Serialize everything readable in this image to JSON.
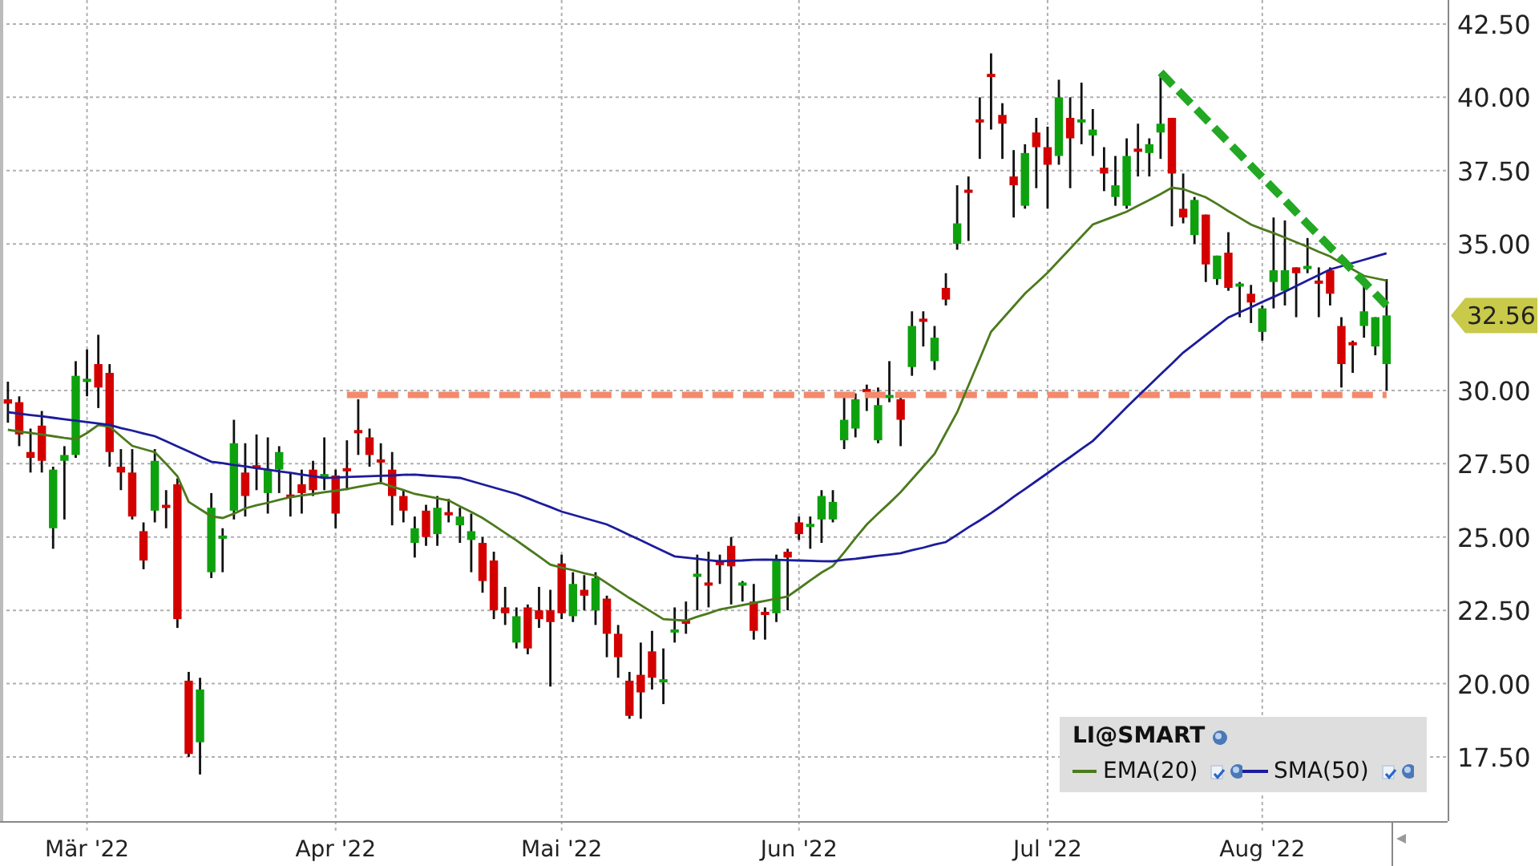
{
  "chart": {
    "chart_data": {
      "type": "candlestick",
      "grid": true,
      "categories": [
        null,
        null,
        null,
        null,
        null,
        null,
        null,
        "Mär '22",
        null,
        null,
        null,
        null,
        null,
        null,
        null,
        null,
        null,
        null,
        null,
        null,
        null,
        null,
        null,
        null,
        null,
        null,
        null,
        null,
        null,
        "Apr '22",
        null,
        null,
        null,
        null,
        null,
        null,
        null,
        null,
        null,
        null,
        null,
        null,
        null,
        null,
        null,
        null,
        null,
        null,
        null,
        "Mai '22",
        null,
        null,
        null,
        null,
        null,
        null,
        null,
        null,
        null,
        null,
        null,
        null,
        null,
        null,
        null,
        null,
        null,
        null,
        null,
        null,
        "Jun '22",
        null,
        null,
        null,
        null,
        null,
        null,
        null,
        null,
        null,
        null,
        null,
        null,
        null,
        null,
        null,
        null,
        null,
        null,
        null,
        null,
        null,
        "Jul '22",
        null,
        null,
        null,
        null,
        null,
        null,
        null,
        null,
        null,
        null,
        null,
        null,
        null,
        null,
        null,
        null,
        null,
        null,
        "Aug '22",
        null,
        null,
        null,
        null,
        null,
        null,
        null,
        null,
        null,
        null,
        null
      ],
      "ylim": [
        15.31,
        43.32
      ],
      "yticks": [
        {
          "value": 17.5,
          "label": "17.50"
        },
        {
          "value": 20,
          "label": "20.00"
        },
        {
          "value": 22.5,
          "label": "22.50"
        },
        {
          "value": 25,
          "label": "25.00"
        },
        {
          "value": 27.5,
          "label": "27.50"
        },
        {
          "value": 30,
          "label": "30.00"
        },
        {
          "value": 35,
          "label": "35.00"
        },
        {
          "value": 37.5,
          "label": "37.50"
        },
        {
          "value": 40,
          "label": "40.00"
        },
        {
          "value": 42.5,
          "label": "42.50"
        }
      ],
      "ohlc": [
        [
          29.7,
          30.3,
          28.9,
          29.55
        ],
        [
          29.6,
          29.8,
          28.1,
          28.5
        ],
        [
          27.9,
          28.7,
          27.2,
          27.7
        ],
        [
          28.8,
          29.3,
          27.2,
          27.6
        ],
        [
          25.3,
          27.4,
          24.6,
          27.3
        ],
        [
          27.6,
          28.1,
          25.6,
          27.8
        ],
        [
          27.8,
          31.0,
          27.7,
          30.5
        ],
        [
          30.3,
          31.4,
          29.8,
          30.4
        ],
        [
          30.9,
          31.9,
          29.4,
          30.1
        ],
        [
          30.6,
          30.9,
          27.4,
          27.9
        ],
        [
          27.4,
          28.0,
          26.6,
          27.2
        ],
        [
          27.2,
          28.0,
          25.6,
          25.7
        ],
        [
          25.2,
          25.5,
          23.9,
          24.2
        ],
        [
          25.9,
          28.0,
          25.5,
          27.6
        ],
        [
          26.1,
          26.6,
          25.3,
          26.0
        ],
        [
          26.8,
          27.0,
          21.9,
          22.2
        ],
        [
          20.1,
          20.4,
          17.5,
          17.6
        ],
        [
          18.0,
          20.2,
          16.9,
          19.8
        ],
        [
          23.8,
          26.5,
          23.6,
          26.0
        ],
        [
          24.95,
          25.3,
          23.8,
          25.05
        ],
        [
          25.9,
          29.0,
          25.6,
          28.2
        ],
        [
          27.2,
          28.2,
          25.7,
          26.4
        ],
        [
          27.45,
          28.5,
          26.6,
          27.35
        ],
        [
          26.5,
          28.4,
          25.8,
          27.3
        ],
        [
          27.3,
          28.1,
          26.5,
          27.9
        ],
        [
          26.45,
          27.2,
          25.7,
          26.35
        ],
        [
          26.8,
          27.3,
          25.8,
          26.5
        ],
        [
          27.3,
          27.6,
          26.4,
          26.6
        ],
        [
          27.05,
          28.4,
          26.6,
          27.15
        ],
        [
          27.1,
          27.3,
          25.3,
          25.8
        ],
        [
          27.35,
          28.3,
          26.6,
          27.25
        ],
        [
          28.65,
          29.7,
          27.8,
          28.55
        ],
        [
          28.4,
          28.7,
          27.4,
          27.8
        ],
        [
          27.65,
          28.2,
          26.8,
          27.55
        ],
        [
          27.3,
          27.9,
          25.4,
          26.4
        ],
        [
          26.4,
          26.6,
          25.5,
          25.9
        ],
        [
          24.8,
          25.7,
          24.3,
          25.3
        ],
        [
          25.9,
          26.1,
          24.7,
          25.0
        ],
        [
          25.1,
          26.4,
          24.7,
          26.0
        ],
        [
          25.85,
          26.3,
          25.5,
          25.75
        ],
        [
          25.4,
          26.0,
          24.8,
          25.7
        ],
        [
          24.9,
          25.8,
          23.8,
          25.2
        ],
        [
          24.8,
          25.0,
          23.1,
          23.5
        ],
        [
          24.2,
          24.5,
          22.2,
          22.5
        ],
        [
          22.6,
          23.3,
          22.0,
          22.4
        ],
        [
          21.4,
          22.6,
          21.2,
          22.3
        ],
        [
          22.6,
          22.7,
          21.0,
          21.2
        ],
        [
          22.5,
          23.3,
          21.9,
          22.2
        ],
        [
          22.5,
          23.2,
          19.9,
          22.1
        ],
        [
          24.1,
          24.4,
          22.2,
          22.4
        ],
        [
          22.3,
          23.8,
          22.1,
          23.4
        ],
        [
          23.2,
          23.7,
          22.5,
          23.0
        ],
        [
          22.5,
          23.8,
          22.0,
          23.6
        ],
        [
          22.9,
          23.0,
          20.9,
          21.7
        ],
        [
          21.7,
          22.0,
          20.2,
          20.9
        ],
        [
          20.1,
          20.4,
          18.8,
          18.9
        ],
        [
          20.3,
          21.4,
          18.8,
          19.7
        ],
        [
          21.1,
          21.8,
          19.8,
          20.2
        ],
        [
          20.05,
          21.2,
          19.3,
          20.15
        ],
        [
          21.75,
          22.6,
          21.4,
          21.85
        ],
        [
          22.15,
          22.8,
          21.7,
          22.05
        ],
        [
          23.65,
          24.4,
          22.5,
          23.75
        ],
        [
          23.45,
          24.5,
          22.6,
          23.35
        ],
        [
          24.15,
          24.4,
          23.4,
          24.05
        ],
        [
          24.7,
          25.0,
          22.7,
          24.0
        ],
        [
          23.35,
          23.5,
          22.8,
          23.45
        ],
        [
          22.8,
          23.4,
          21.5,
          21.8
        ],
        [
          22.45,
          22.6,
          21.5,
          22.35
        ],
        [
          22.4,
          24.4,
          22.1,
          24.2
        ],
        [
          24.5,
          24.6,
          22.5,
          24.3
        ],
        [
          25.5,
          25.7,
          24.9,
          25.1
        ],
        [
          25.35,
          25.7,
          24.6,
          25.45
        ],
        [
          25.6,
          26.6,
          24.8,
          26.4
        ],
        [
          25.6,
          26.6,
          25.5,
          26.2
        ],
        [
          28.3,
          29.9,
          28.0,
          29.0
        ],
        [
          28.7,
          29.9,
          28.4,
          29.7
        ],
        [
          30.05,
          30.2,
          29.3,
          29.95
        ],
        [
          28.3,
          30.1,
          28.2,
          29.5
        ],
        [
          29.75,
          31.0,
          29.6,
          29.85
        ],
        [
          29.7,
          29.9,
          28.1,
          29.0
        ],
        [
          30.8,
          32.7,
          30.5,
          32.2
        ],
        [
          32.45,
          32.7,
          31.5,
          32.35
        ],
        [
          31.0,
          32.2,
          30.7,
          31.8
        ],
        [
          33.5,
          34.0,
          32.9,
          33.1
        ],
        [
          35.0,
          37.0,
          34.8,
          35.7
        ],
        [
          36.85,
          37.3,
          35.1,
          36.75
        ],
        [
          39.25,
          40.0,
          37.9,
          39.15
        ],
        [
          40.8,
          41.5,
          38.9,
          40.7
        ],
        [
          39.4,
          39.8,
          37.9,
          39.1
        ],
        [
          37.3,
          38.2,
          35.9,
          37.0
        ],
        [
          36.3,
          38.4,
          36.2,
          38.1
        ],
        [
          38.8,
          39.3,
          36.9,
          38.3
        ],
        [
          38.3,
          39.0,
          36.2,
          37.7
        ],
        [
          38.0,
          40.6,
          37.7,
          40.0
        ],
        [
          39.3,
          40.0,
          36.9,
          38.6
        ],
        [
          39.15,
          40.5,
          38.4,
          39.25
        ],
        [
          38.7,
          39.6,
          38.0,
          38.9
        ],
        [
          37.6,
          38.3,
          36.8,
          37.4
        ],
        [
          36.6,
          38.0,
          36.3,
          37.0
        ],
        [
          36.3,
          38.6,
          36.2,
          38.0
        ],
        [
          38.25,
          39.1,
          37.3,
          38.15
        ],
        [
          38.1,
          38.6,
          37.3,
          38.4
        ],
        [
          38.8,
          40.8,
          37.9,
          39.1
        ],
        [
          39.3,
          39.3,
          35.6,
          37.4
        ],
        [
          36.2,
          37.4,
          35.7,
          35.9
        ],
        [
          35.3,
          36.6,
          35.0,
          36.5
        ],
        [
          36.0,
          36.0,
          33.7,
          34.3
        ],
        [
          33.8,
          34.6,
          33.6,
          34.6
        ],
        [
          34.7,
          35.4,
          33.4,
          33.5
        ],
        [
          33.55,
          33.7,
          32.5,
          33.65
        ],
        [
          33.3,
          33.6,
          32.3,
          33.0
        ],
        [
          32.0,
          32.9,
          31.7,
          32.8
        ],
        [
          33.7,
          35.9,
          32.8,
          34.1
        ],
        [
          33.4,
          35.8,
          32.9,
          34.1
        ],
        [
          34.2,
          34.2,
          32.5,
          34.0
        ],
        [
          34.15,
          35.2,
          34.0,
          34.25
        ],
        [
          33.75,
          34.2,
          32.5,
          33.65
        ],
        [
          34.1,
          34.2,
          32.9,
          33.3
        ],
        [
          32.2,
          32.5,
          30.1,
          30.9
        ],
        [
          31.65,
          31.7,
          30.6,
          31.55
        ],
        [
          32.2,
          33.6,
          31.8,
          32.7
        ],
        [
          31.5,
          32.5,
          31.2,
          32.5
        ],
        [
          30.9,
          33.8,
          30.0,
          32.56
        ]
      ],
      "annotations": [
        "32.56"
      ]
    },
    "indicators": {
      "chart_data": {
        "type": "line",
        "legend": "lower right",
        "ylim": [
          15.31,
          43.32
        ],
        "series": [
          {
            "name": "EMA(20)",
            "color": "#4b7a1c",
            "values": [
              28.66,
              28.6,
              28.55,
              28.5,
              28.44,
              28.38,
              28.33,
              28.55,
              28.82,
              28.77,
              28.44,
              28.11,
              28.0,
              27.89,
              27.5,
              27.07,
              26.2,
              25.95,
              25.71,
              25.65,
              25.8,
              25.98,
              26.08,
              26.17,
              26.27,
              26.36,
              26.42,
              26.47,
              26.53,
              26.58,
              26.64,
              26.71,
              26.78,
              26.85,
              26.72,
              26.6,
              26.47,
              26.4,
              26.32,
              26.25,
              26.05,
              25.85,
              25.65,
              25.4,
              25.14,
              24.89,
              24.61,
              24.34,
              24.06,
              23.96,
              23.87,
              23.77,
              23.68,
              23.43,
              23.17,
              22.92,
              22.68,
              22.44,
              22.2,
              22.17,
              22.15,
              22.28,
              22.4,
              22.53,
              22.6,
              22.68,
              22.75,
              22.82,
              22.9,
              22.97,
              23.24,
              23.52,
              23.79,
              24.01,
              24.48,
              24.96,
              25.43,
              25.8,
              26.16,
              26.53,
              26.97,
              27.4,
              27.84,
              28.55,
              29.26,
              30.17,
              31.09,
              32.0,
              32.44,
              32.87,
              33.31,
              33.66,
              34.02,
              34.43,
              34.84,
              35.25,
              35.66,
              35.81,
              35.95,
              36.1,
              36.3,
              36.5,
              36.7,
              36.92,
              36.87,
              36.73,
              36.59,
              36.36,
              36.12,
              35.89,
              35.66,
              35.51,
              35.37,
              35.22,
              35.06,
              34.9,
              34.73,
              34.57,
              34.35,
              34.13,
              33.91,
              33.83,
              33.75
            ]
          },
          {
            "name": "SMA(50)",
            "color": "#1c1c9c",
            "values": [
              29.26,
              29.21,
              29.16,
              29.12,
              29.07,
              29.02,
              28.97,
              28.92,
              28.87,
              28.82,
              28.72,
              28.63,
              28.53,
              28.44,
              28.27,
              28.09,
              27.92,
              27.74,
              27.57,
              27.52,
              27.46,
              27.41,
              27.35,
              27.3,
              27.24,
              27.19,
              27.13,
              27.08,
              27.02,
              27.03,
              27.05,
              27.06,
              27.08,
              27.09,
              27.1,
              27.12,
              27.13,
              27.1,
              27.08,
              27.05,
              27.02,
              26.91,
              26.8,
              26.69,
              26.58,
              26.47,
              26.32,
              26.17,
              26.02,
              25.87,
              25.76,
              25.65,
              25.54,
              25.43,
              25.25,
              25.07,
              24.89,
              24.71,
              24.52,
              24.34,
              24.3,
              24.26,
              24.21,
              24.17,
              24.19,
              24.2,
              24.22,
              24.23,
              24.22,
              24.21,
              24.2,
              24.19,
              24.18,
              24.17,
              24.22,
              24.26,
              24.31,
              24.36,
              24.4,
              24.45,
              24.55,
              24.64,
              24.74,
              24.83,
              25.08,
              25.33,
              25.57,
              25.82,
              26.09,
              26.37,
              26.64,
              26.91,
              27.18,
              27.46,
              27.73,
              28.01,
              28.28,
              28.66,
              29.04,
              29.43,
              29.81,
              30.18,
              30.55,
              30.92,
              31.29,
              31.59,
              31.89,
              32.19,
              32.49,
              32.67,
              32.84,
              33.02,
              33.19,
              33.37,
              33.56,
              33.75,
              33.94,
              34.13,
              34.24,
              34.35,
              34.46,
              34.57,
              34.68
            ]
          },
          {
            "color": "#f4896b",
            "line_style": "dashed",
            "values": [
              null,
              null,
              null,
              null,
              null,
              null,
              null,
              null,
              null,
              null,
              null,
              null,
              null,
              null,
              null,
              null,
              null,
              null,
              null,
              null,
              null,
              null,
              null,
              null,
              null,
              null,
              null,
              null,
              null,
              null,
              29.85,
              29.85,
              29.85,
              29.85,
              29.85,
              29.85,
              29.85,
              29.85,
              29.85,
              29.85,
              29.85,
              29.85,
              29.85,
              29.85,
              29.85,
              29.85,
              29.85,
              29.85,
              29.85,
              29.85,
              29.85,
              29.85,
              29.85,
              29.85,
              29.85,
              29.85,
              29.85,
              29.85,
              29.85,
              29.85,
              29.85,
              29.85,
              29.85,
              29.85,
              29.85,
              29.85,
              29.85,
              29.85,
              29.85,
              29.85,
              29.85,
              29.85,
              29.85,
              29.85,
              29.85,
              29.85,
              29.85,
              29.85,
              29.85,
              29.85,
              29.85,
              29.85,
              29.85,
              29.85,
              29.85,
              29.85,
              29.85,
              29.85,
              29.85,
              29.85,
              29.85,
              29.85,
              29.85,
              29.85,
              29.85,
              29.85,
              29.85,
              29.85,
              29.85,
              29.85,
              29.85,
              29.85,
              29.85,
              29.85,
              29.85,
              29.85,
              29.85,
              29.85,
              29.85,
              29.85,
              29.85,
              29.85,
              29.85,
              29.85,
              29.85,
              29.85,
              29.85,
              29.85,
              29.85,
              29.85,
              29.85,
              29.85,
              29.85
            ]
          },
          {
            "color": "#22a822",
            "line_style": "dashed",
            "values": [
              null,
              null,
              null,
              null,
              null,
              null,
              null,
              null,
              null,
              null,
              null,
              null,
              null,
              null,
              null,
              null,
              null,
              null,
              null,
              null,
              null,
              null,
              null,
              null,
              null,
              null,
              null,
              null,
              null,
              null,
              null,
              null,
              null,
              null,
              null,
              null,
              null,
              null,
              null,
              null,
              null,
              null,
              null,
              null,
              null,
              null,
              null,
              null,
              null,
              null,
              null,
              null,
              null,
              null,
              null,
              null,
              null,
              null,
              null,
              null,
              null,
              null,
              null,
              null,
              null,
              null,
              null,
              null,
              null,
              null,
              null,
              null,
              null,
              null,
              null,
              null,
              null,
              null,
              null,
              null,
              null,
              null,
              null,
              null,
              null,
              null,
              null,
              null,
              null,
              null,
              null,
              null,
              null,
              null,
              null,
              null,
              null,
              null,
              null,
              null,
              null,
              null,
              40.85,
              40.45,
              40.06,
              39.66,
              39.26,
              38.86,
              38.47,
              38.07,
              37.67,
              37.27,
              36.88,
              36.48,
              36.08,
              35.68,
              35.29,
              34.89,
              34.49,
              34.09,
              33.7,
              33.3,
              32.9
            ]
          }
        ]
      }
    },
    "legend_panel": {
      "title": "LI@SMART",
      "items": [
        {
          "checked": true
        },
        {
          "checked": true
        }
      ]
    }
  }
}
